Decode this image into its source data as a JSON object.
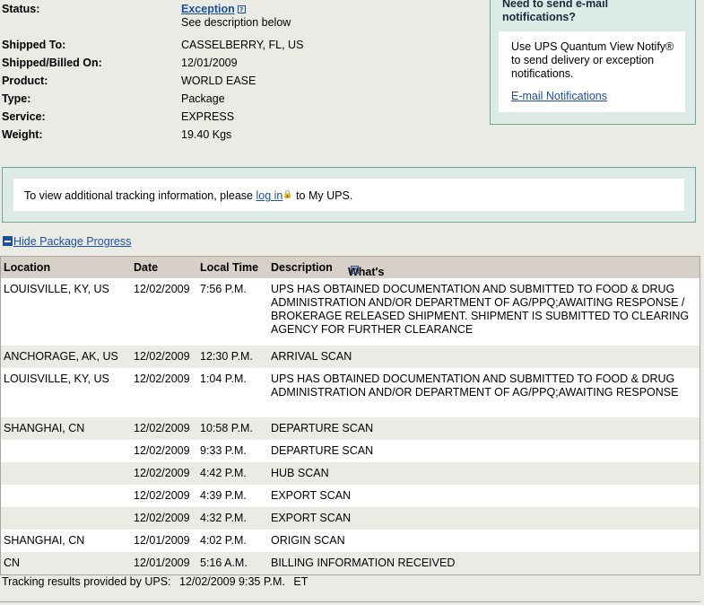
{
  "details": {
    "status_label": "Status:",
    "status_value": "Exception",
    "status_note": "See description below",
    "rows": [
      {
        "label": "Shipped To:",
        "value": "CASSELBERRY, FL, US"
      },
      {
        "label": "Shipped/Billed On:",
        "value": "12/01/2009"
      },
      {
        "label": "Product:",
        "value": "WORLD EASE"
      },
      {
        "label": "Type:",
        "value": "Package"
      },
      {
        "label": "Service:",
        "value": "EXPRESS"
      },
      {
        "label": "Weight:",
        "value": "19.40 Kgs"
      }
    ]
  },
  "notify": {
    "title_line1": "Need to send e-mail",
    "title_line2": "notifications?",
    "body": "Use UPS Quantum View Notify® to send delivery or exception notifications.",
    "link": "E-mail Notifications"
  },
  "login_box": {
    "before": "To view additional tracking information, please",
    "link": "log in",
    "after": "to My UPS."
  },
  "toggle_label": "Hide Package Progress",
  "progress": {
    "headers": {
      "location": "Location",
      "date": "Date",
      "time": "Local Time",
      "description": "Description",
      "whats_this": "What's This?"
    },
    "rows": [
      {
        "location": "LOUISVILLE, KY, US",
        "date": "12/02/2009",
        "time": "7:56 P.M.",
        "description": "UPS HAS OBTAINED DOCUMENTATION AND SUBMITTED TO FOOD & DRUG ADMINISTRATION AND/OR DEPARTMENT OF AG/PPQ;AWAITING RESPONSE / BROKERAGE RELEASED SHIPMENT. SHIPMENT IS SUBMITTED TO CLEARING AGENCY FOR FURTHER CLEARANCE"
      },
      {
        "location": "ANCHORAGE, AK, US",
        "date": "12/02/2009",
        "time": "12:30 P.M.",
        "description": "ARRIVAL SCAN"
      },
      {
        "location": "LOUISVILLE, KY, US",
        "date": "12/02/2009",
        "time": "1:04 P.M.",
        "description": "UPS HAS OBTAINED DOCUMENTATION AND SUBMITTED TO FOOD & DRUG ADMINISTRATION AND/OR DEPARTMENT OF AG/PPQ;AWAITING RESPONSE"
      },
      {
        "location": "SHANGHAI, CN",
        "date": "12/02/2009",
        "time": "10:58 P.M.",
        "description": "DEPARTURE SCAN"
      },
      {
        "location": "",
        "date": "12/02/2009",
        "time": "9:33 P.M.",
        "description": "DEPARTURE SCAN"
      },
      {
        "location": "",
        "date": "12/02/2009",
        "time": "4:42 P.M.",
        "description": "HUB SCAN"
      },
      {
        "location": "",
        "date": "12/02/2009",
        "time": "4:39 P.M.",
        "description": "EXPORT SCAN"
      },
      {
        "location": "",
        "date": "12/02/2009",
        "time": "4:32 P.M.",
        "description": "EXPORT SCAN"
      },
      {
        "location": "SHANGHAI, CN",
        "date": "12/01/2009",
        "time": "4:02 P.M.",
        "description": "ORIGIN SCAN"
      },
      {
        "location": "CN",
        "date": "12/01/2009",
        "time": "5:16 A.M.",
        "description": "BILLING INFORMATION RECEIVED"
      }
    ]
  },
  "footer": {
    "label": "Tracking results provided by UPS:",
    "timestamp": "12/02/2009 9:35 P.M.",
    "zone": "ET"
  },
  "colors": {
    "link": "#1c4fa0",
    "panel_bg": "#dcebe5",
    "panel_border": "#6fa796",
    "header_bg": "#d6d0c6"
  }
}
